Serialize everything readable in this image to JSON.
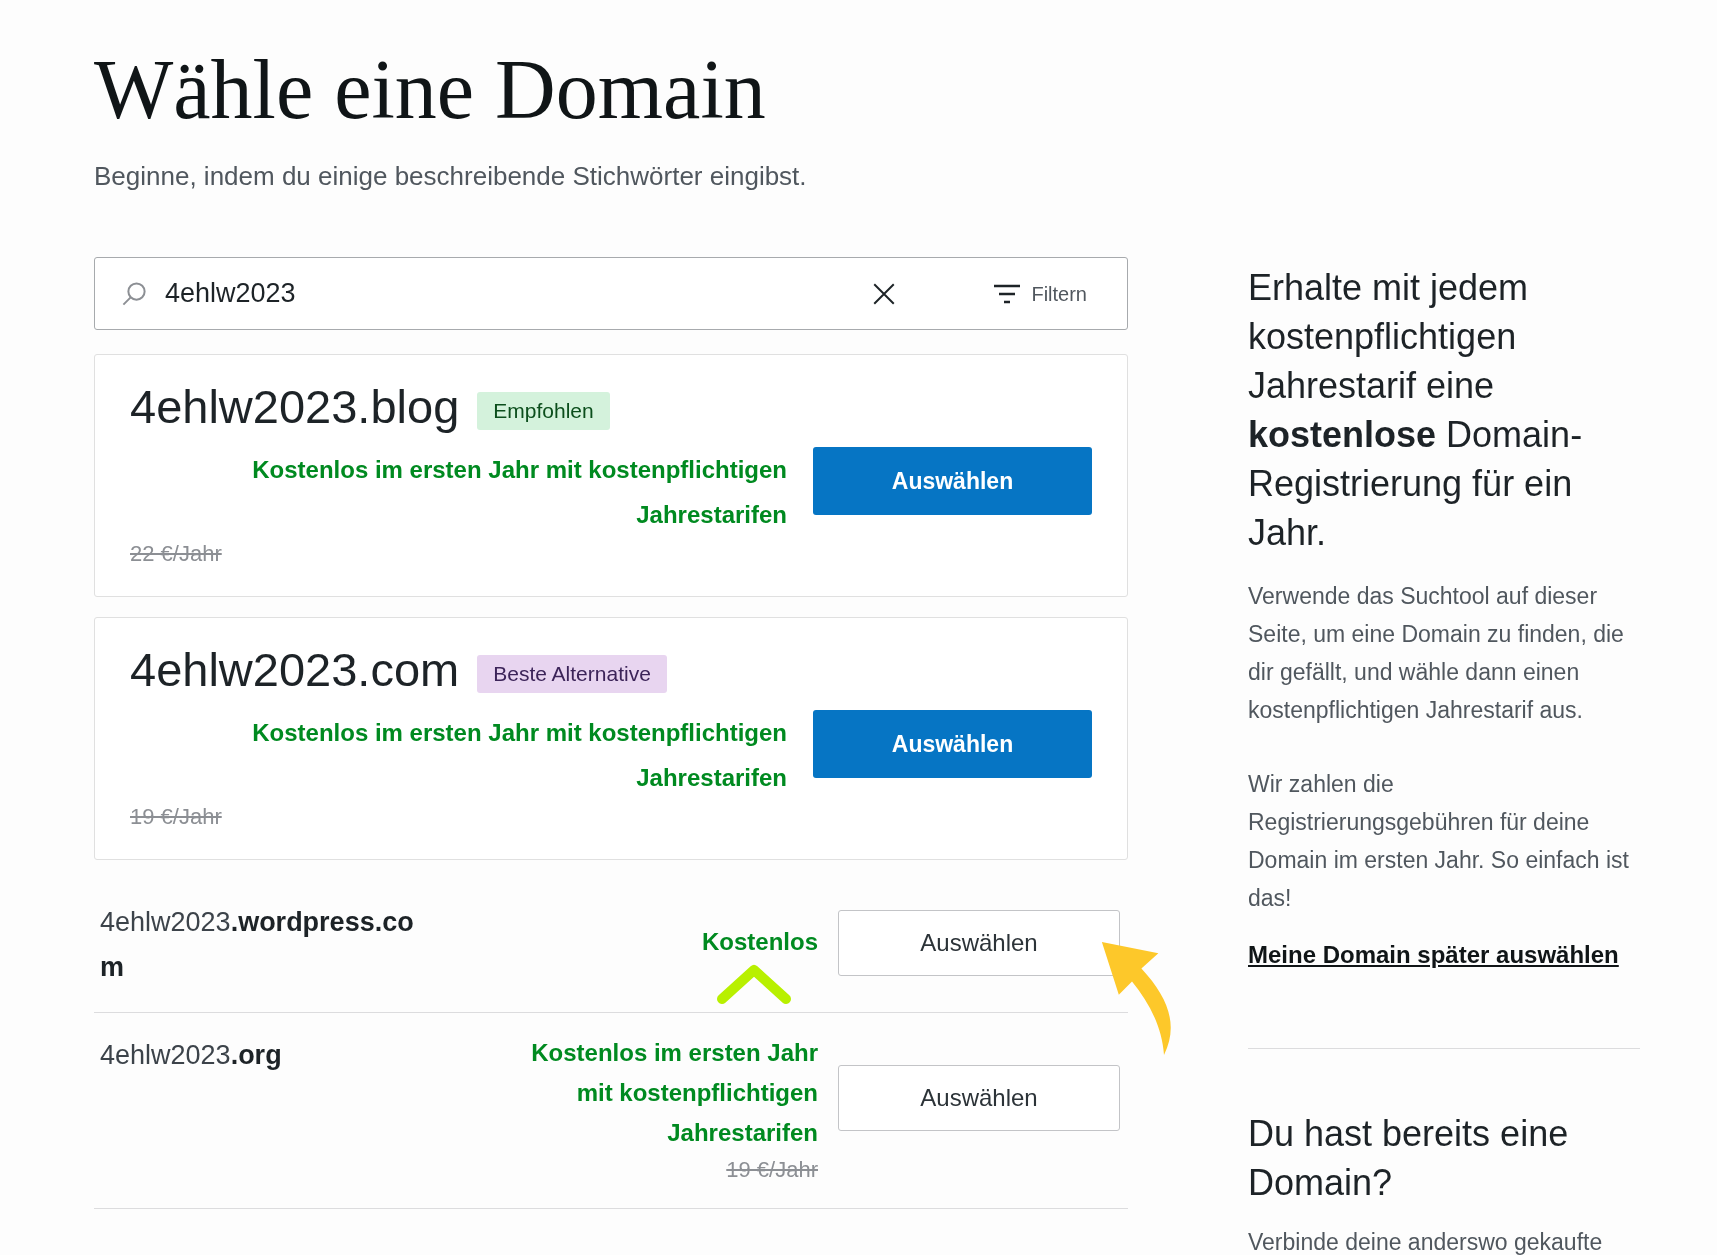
{
  "title": "Wähle eine Domain",
  "subtitle": "Beginne, indem du einige beschreibende Stichwörter eingibst.",
  "search": {
    "value": "4ehlw2023",
    "filter_label": "Filtern"
  },
  "domains": [
    {
      "kind": "featured",
      "name": "4ehlw2023.blog",
      "badge": {
        "label": "Empfohlen",
        "kind": "recommended"
      },
      "offer": "Kostenlos im ersten Jahr mit kostenpflichtigen Jahrestarifen",
      "price": "22 €/Jahr",
      "button": "Auswählen"
    },
    {
      "kind": "featured",
      "name": "4ehlw2023.com",
      "badge": {
        "label": "Beste Alternative",
        "kind": "alternative"
      },
      "offer": "Kostenlos im ersten Jahr mit kostenpflichtigen Jahrestarifen",
      "price": "19 €/Jahr",
      "button": "Auswählen"
    },
    {
      "kind": "plain",
      "name": "4ehlw2023",
      "tld": ".wordpress.com",
      "offer": "Kostenlos",
      "button": "Auswählen"
    },
    {
      "kind": "plain",
      "name": "4ehlw2023",
      "tld": ".org",
      "offer": "Kostenlos im ersten Jahr mit kostenpflichtigen Jahrestarifen",
      "price": "19 €/Jahr",
      "button": "Auswählen"
    }
  ],
  "sidebar": {
    "heading": "Erhalte mit jedem kostenpflichtigen Jahrestarif eine **kostenlose** Domain-Registrierung für ein Jahr.",
    "paragraphs": [
      "Verwende das Suchtool auf dieser Seite, um eine Domain zu finden, die dir gefällt, und wähle dann einen kostenpflichtigen Jahrestarif aus.",
      "Wir zahlen die Registrierungsgebühren für deine Domain im ersten Jahr. So einfach ist das!"
    ],
    "link": "Meine Domain später auswählen",
    "heading2": "Du hast bereits eine Domain?",
    "text2": "Verbinde deine anderswo gekaufte"
  }
}
